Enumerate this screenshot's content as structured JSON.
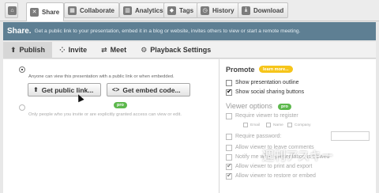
{
  "tabs": [
    {
      "label": "",
      "icon": "home-icon"
    },
    {
      "label": "Share",
      "icon": "share-icon"
    },
    {
      "label": "Collaborate",
      "icon": "collaborate-icon"
    },
    {
      "label": "Analytics",
      "icon": "analytics-icon"
    },
    {
      "label": "Tags",
      "icon": "tag-icon"
    },
    {
      "label": "History",
      "icon": "history-icon"
    },
    {
      "label": "Download",
      "icon": "download-icon"
    }
  ],
  "banner": {
    "title": "Share.",
    "description": "Get a public link to your presentation, embed it in a blog or website, invites others to view or start a remote meeting."
  },
  "subnav": {
    "publish": "Publish",
    "invite": "Invite",
    "meet": "Meet",
    "playback": "Playback Settings"
  },
  "publish": {
    "public_desc": "Anyone can view this presentation with a public link or when embedded.",
    "get_link": "Get public link...",
    "get_embed": "Get embed code...",
    "pro_badge": "pro",
    "private_desc": "Only people who you invite or are explicitly granted access can view or edit."
  },
  "promote": {
    "title": "Promote",
    "learn_more": "learn more...",
    "show_outline": "Show presentation outline",
    "show_social": "Show social sharing buttons"
  },
  "viewer_options": {
    "title": "Viewer options",
    "pro_badge": "pro",
    "require_register": "Require viewer to register",
    "field_email": "Email",
    "field_name": "Name",
    "field_company": "Company",
    "require_password": "Require password:",
    "allow_comments": "Allow viewer to leave comments",
    "notify_viewed": "Notify me when presentation is viewed",
    "allow_export": "Allow viewer to print and export",
    "allow_restore": "Allow viewer to restore or embed"
  },
  "watermark": "週刊アスキー"
}
